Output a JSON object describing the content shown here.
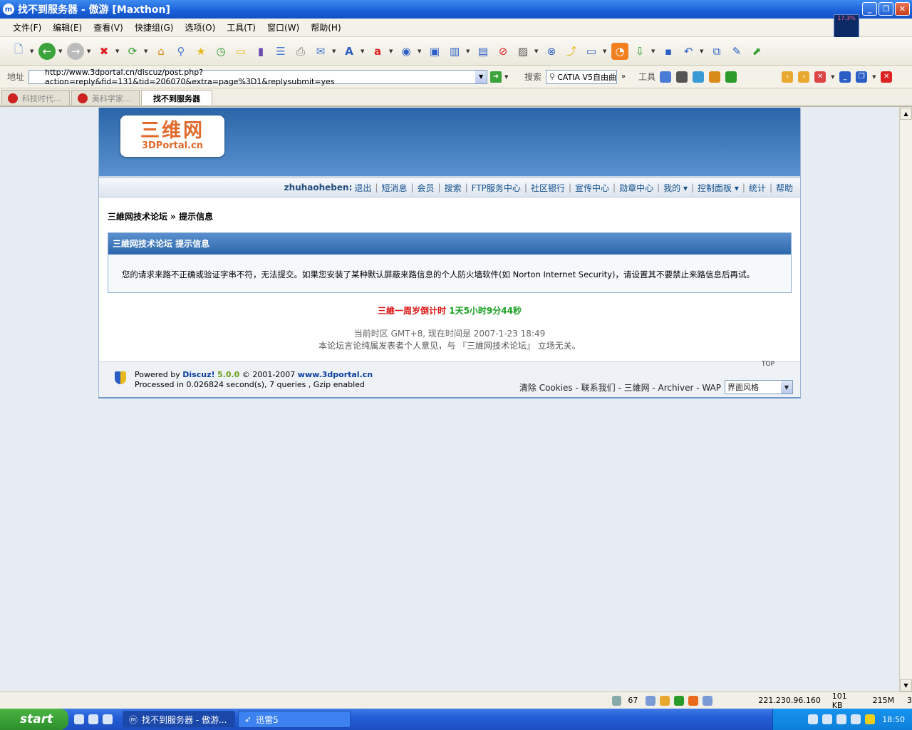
{
  "window": {
    "title": "找不到服务器 - 傲游 [Maxthon]",
    "app_icon": "m"
  },
  "menu": [
    "文件(F)",
    "编辑(E)",
    "查看(V)",
    "快捷组(G)",
    "选项(O)",
    "工具(T)",
    "窗口(W)",
    "帮助(H)"
  ],
  "net_meter": "17.3%",
  "address": {
    "label": "地址",
    "url": "http://www.3dportal.cn/discuz/post.php?action=reply&fid=131&tid=206070&extra=page%3D1&replysubmit=yes"
  },
  "search": {
    "label": "搜索",
    "value": "CATIA V5自由曲"
  },
  "tools_label": "工具",
  "tabs": [
    "科技时代...",
    "美科学家...",
    "找不到服务器"
  ],
  "site": {
    "logo_cn": "三维网",
    "logo_en": "3DPortal.cn",
    "nav_user": "zhuhaoheben:",
    "nav": [
      "退出",
      "短消息",
      "会员",
      "搜索",
      "FTP服务中心",
      "社区银行",
      "宣传中心",
      "勋章中心",
      "我的 ▾",
      "控制面板 ▾",
      "统计",
      "帮助"
    ],
    "breadcrumb": "三維网技术论坛 » 提示信息",
    "msg_title": "三維网技术论坛  提示信息",
    "msg_body": "您的请求来路不正确或验证字串不符，无法提交。如果您安装了某种默认屏蔽来路信息的个人防火墙软件(如 Norton Internet Security)，请设置其不要禁止来路信息后再试。",
    "countdown_label": "三維一周岁倒计时",
    "countdown_value": "1天5小时9分44秒",
    "time_line": "当前时区 GMT+8, 现在时间是 2007-1-23 18:49",
    "disclaimer": "本论坛言论纯属发表者个人意见，与 『三維网技术论坛』 立场无关。",
    "top": "TOP",
    "powered_prefix": "Powered by",
    "powered_name": "Discuz!",
    "powered_ver": "5.0.0",
    "copyright": "© 2001-2007",
    "site_link": "www.3dportal.cn",
    "processed": "Processed in 0.026824 second(s), 7 queries , Gzip enabled",
    "footer_links": "清除 Cookies - 联系我们 - 三維网 - Archiver - WAP",
    "style_select": "界面风格"
  },
  "status": {
    "count": "67",
    "ip": "221.230.96.160",
    "size": "101 KB",
    "mem": "215M",
    "num": "3"
  },
  "taskbar": {
    "start": "start",
    "task1": "找不到服务器 - 傲游...",
    "task2": "迅雷5",
    "clock": "18:50"
  }
}
